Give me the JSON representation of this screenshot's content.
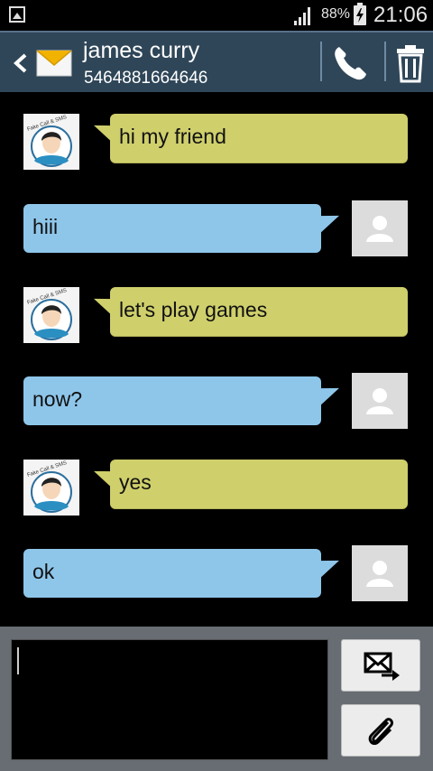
{
  "status_bar": {
    "battery_percent": "88%",
    "time": "21:06"
  },
  "header": {
    "contact_name": "james curry",
    "contact_number": "5464881664646"
  },
  "messages": [
    {
      "direction": "incoming",
      "text": "hi my friend"
    },
    {
      "direction": "outgoing",
      "text": "hiii"
    },
    {
      "direction": "incoming",
      "text": "let's play games"
    },
    {
      "direction": "outgoing",
      "text": "now?"
    },
    {
      "direction": "incoming",
      "text": "yes"
    },
    {
      "direction": "outgoing",
      "text": "ok"
    }
  ],
  "composer": {
    "value": "",
    "placeholder": ""
  },
  "avatar_badge": "Fake Call & SMS",
  "colors": {
    "header_bg": "#2f4658",
    "incoming_bubble": "#cfcf6c",
    "outgoing_bubble": "#8ec6ea",
    "composer_bg": "#676d73"
  }
}
